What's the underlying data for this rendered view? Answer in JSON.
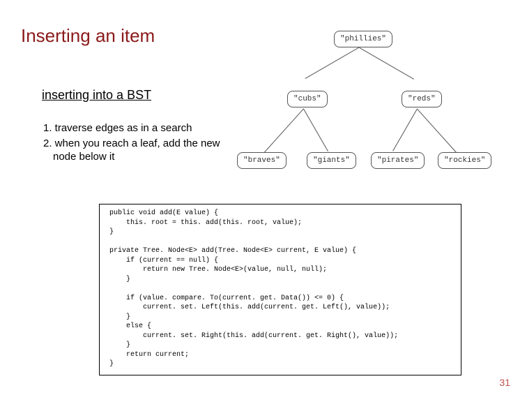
{
  "title": "Inserting an item",
  "subtitle": "inserting into a BST",
  "steps": {
    "s1": "1. traverse edges as in a search",
    "s2": "2. when you reach a leaf, add the new node below it"
  },
  "tree": {
    "root": "\"phillies\"",
    "l": "\"cubs\"",
    "r": "\"reds\"",
    "ll": "\"braves\"",
    "lr": "\"giants\"",
    "rl": "\"pirates\"",
    "rr": "\"rockies\""
  },
  "code": " public void add(E value) {\n     this. root = this. add(this. root, value);\n }\n\n private Tree. Node<E> add(Tree. Node<E> current, E value) {\n     if (current == null) {\n         return new Tree. Node<E>(value, null, null);\n     }\n\n     if (value. compare. To(current. get. Data()) <= 0) {\n         current. set. Left(this. add(current. get. Left(), value));\n     }\n     else {\n         current. set. Right(this. add(current. get. Right(), value));\n     }\n     return current;\n }",
  "page_number": "31"
}
